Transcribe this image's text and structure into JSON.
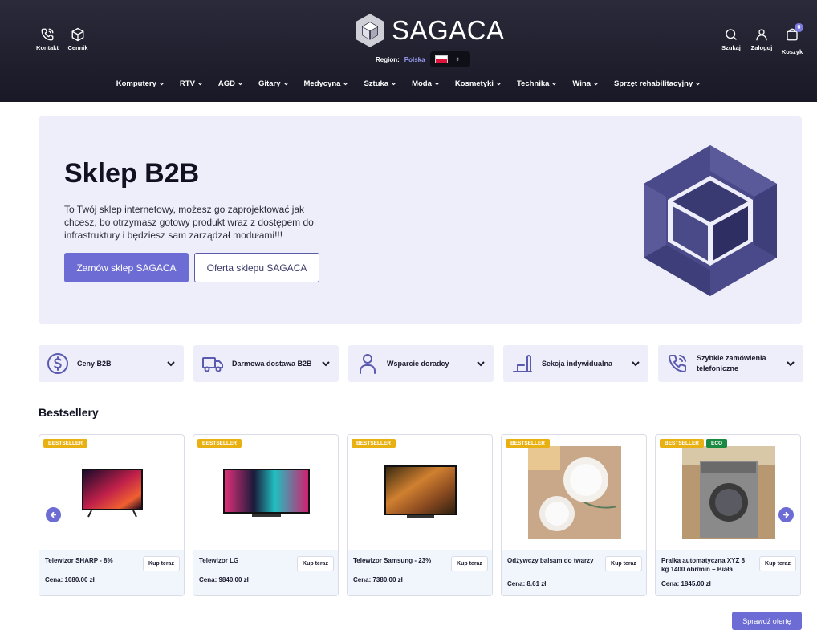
{
  "header": {
    "left": [
      {
        "label": "Kontakt",
        "icon": "phone-icon"
      },
      {
        "label": "Cennik",
        "icon": "box-icon"
      }
    ],
    "brand": "SAGACA",
    "region_label": "Region:",
    "region_value": "Polska",
    "right": [
      {
        "label": "Szukaj",
        "icon": "search-icon"
      },
      {
        "label": "Zaloguj",
        "icon": "user-icon"
      },
      {
        "label": "Koszyk",
        "icon": "cart-icon"
      }
    ],
    "cart_count": "0"
  },
  "nav": [
    "Komputery",
    "RTV",
    "AGD",
    "Gitary",
    "Medycyna",
    "Sztuka",
    "Moda",
    "Kosmetyki",
    "Technika",
    "Wina",
    "Sprzęt rehabilitacyjny"
  ],
  "hero": {
    "title": "Sklep B2B",
    "text": "To Twój sklep internetowy, możesz go zaprojektować jak chcesz, bo otrzymasz gotowy produkt wraz z dostępem do infrastruktury i będziesz sam zarządzał modułami!!!",
    "primary_button": "Zamów sklep SAGACA",
    "secondary_button": "Oferta sklepu SAGACA"
  },
  "features": [
    {
      "label": "Ceny B2B",
      "icon": "dollar-circle-icon"
    },
    {
      "label": "Darmowa dostawa B2B",
      "icon": "truck-icon"
    },
    {
      "label": "Wsparcie doradcy",
      "icon": "person-icon"
    },
    {
      "label": "Sekcja indywidualna",
      "icon": "custom-section-icon"
    },
    {
      "label": "Szybkie zamówienia telefoniczne",
      "icon": "phone-icon"
    }
  ],
  "bestsellers": {
    "title": "Bestsellery",
    "badge": "BESTSELLER",
    "eco_badge": "ECO",
    "buy_label": "Kup teraz",
    "price_prefix": "Cena:",
    "products": [
      {
        "name": "Telewizor SHARP - 8%",
        "price": "1080.00 zł"
      },
      {
        "name": "Telewizor LG",
        "price": "9840.00 zł"
      },
      {
        "name": "Telewizor Samsung - 23%",
        "price": "7380.00 zł"
      },
      {
        "name": "Odżywczy balsam do twarzy",
        "price": "8.61 zł"
      },
      {
        "name": "Pralka automatyczna XYZ 8 kg 1400 obr/min – Biała",
        "price": "1845.00 zł"
      }
    ],
    "offer_button": "Sprawdź ofertę"
  },
  "colors": {
    "accent": "#6c6cd4",
    "header_bg": "#1e1e2c",
    "badge": "#e8b010",
    "eco": "#1a8a40",
    "hero_bg": "#eeeefa"
  }
}
